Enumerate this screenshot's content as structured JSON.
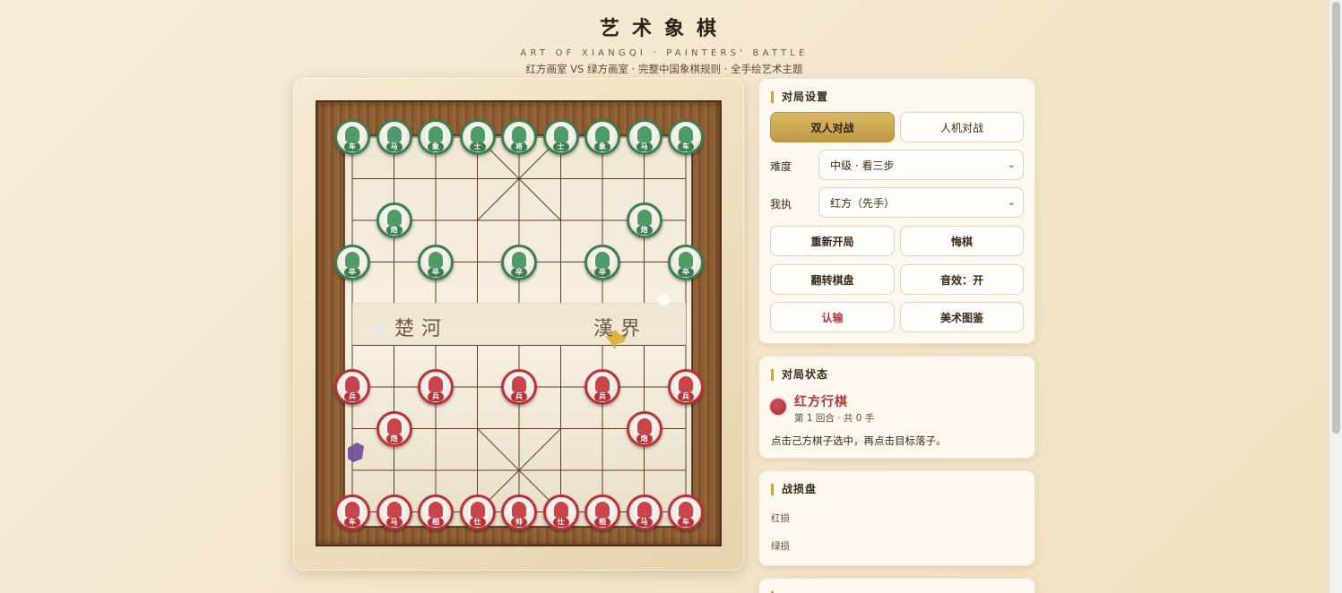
{
  "header": {
    "title": "艺术象棋",
    "subtitle_en": "ART OF XIANGQI · PAINTERS' BATTLE",
    "subtitle_cn": "红方画室 VS 绿方画室 · 完整中国象棋规则 · 全手绘艺术主题"
  },
  "board": {
    "river_left": "楚河",
    "river_right": "漢界",
    "pieces": [
      {
        "side": "green",
        "label": "车",
        "col": 0,
        "row": 0
      },
      {
        "side": "green",
        "label": "马",
        "col": 1,
        "row": 0
      },
      {
        "side": "green",
        "label": "象",
        "col": 2,
        "row": 0
      },
      {
        "side": "green",
        "label": "士",
        "col": 3,
        "row": 0
      },
      {
        "side": "green",
        "label": "将",
        "col": 4,
        "row": 0
      },
      {
        "side": "green",
        "label": "士",
        "col": 5,
        "row": 0
      },
      {
        "side": "green",
        "label": "象",
        "col": 6,
        "row": 0
      },
      {
        "side": "green",
        "label": "马",
        "col": 7,
        "row": 0
      },
      {
        "side": "green",
        "label": "车",
        "col": 8,
        "row": 0
      },
      {
        "side": "green",
        "label": "炮",
        "col": 1,
        "row": 2
      },
      {
        "side": "green",
        "label": "炮",
        "col": 7,
        "row": 2
      },
      {
        "side": "green",
        "label": "卒",
        "col": 0,
        "row": 3
      },
      {
        "side": "green",
        "label": "卒",
        "col": 2,
        "row": 3
      },
      {
        "side": "green",
        "label": "卒",
        "col": 4,
        "row": 3
      },
      {
        "side": "green",
        "label": "卒",
        "col": 6,
        "row": 3
      },
      {
        "side": "green",
        "label": "卒",
        "col": 8,
        "row": 3
      },
      {
        "side": "red",
        "label": "兵",
        "col": 0,
        "row": 6
      },
      {
        "side": "red",
        "label": "兵",
        "col": 2,
        "row": 6
      },
      {
        "side": "red",
        "label": "兵",
        "col": 4,
        "row": 6
      },
      {
        "side": "red",
        "label": "兵",
        "col": 6,
        "row": 6
      },
      {
        "side": "red",
        "label": "兵",
        "col": 8,
        "row": 6
      },
      {
        "side": "red",
        "label": "炮",
        "col": 1,
        "row": 7
      },
      {
        "side": "red",
        "label": "炮",
        "col": 7,
        "row": 7
      },
      {
        "side": "red",
        "label": "车",
        "col": 0,
        "row": 9
      },
      {
        "side": "red",
        "label": "马",
        "col": 1,
        "row": 9
      },
      {
        "side": "red",
        "label": "相",
        "col": 2,
        "row": 9
      },
      {
        "side": "red",
        "label": "仕",
        "col": 3,
        "row": 9
      },
      {
        "side": "red",
        "label": "帅",
        "col": 4,
        "row": 9
      },
      {
        "side": "red",
        "label": "仕",
        "col": 5,
        "row": 9
      },
      {
        "side": "red",
        "label": "相",
        "col": 6,
        "row": 9
      },
      {
        "side": "red",
        "label": "马",
        "col": 7,
        "row": 9
      },
      {
        "side": "red",
        "label": "车",
        "col": 8,
        "row": 9
      }
    ]
  },
  "settings": {
    "title": "对局设置",
    "mode_pvp": "双人对战",
    "mode_ai": "人机对战",
    "difficulty_label": "难度",
    "difficulty_value": "中级 · 看三步",
    "side_label": "我执",
    "side_value": "红方（先手）",
    "restart": "重新开局",
    "undo": "悔棋",
    "flip": "翻转棋盘",
    "sound": "音效：开",
    "resign": "认输",
    "gallery": "美术图鉴"
  },
  "status": {
    "title": "对局状态",
    "turn": "红方行棋",
    "round": "第 1 回合 · 共 0 手",
    "hint": "点击己方棋子选中，再点击目标落子。"
  },
  "losses": {
    "title": "战损盘",
    "red_label": "红损",
    "green_label": "绿损"
  },
  "colors": {
    "red": "#b8323a",
    "green": "#3c7d52",
    "accent": "#c9a24a"
  }
}
